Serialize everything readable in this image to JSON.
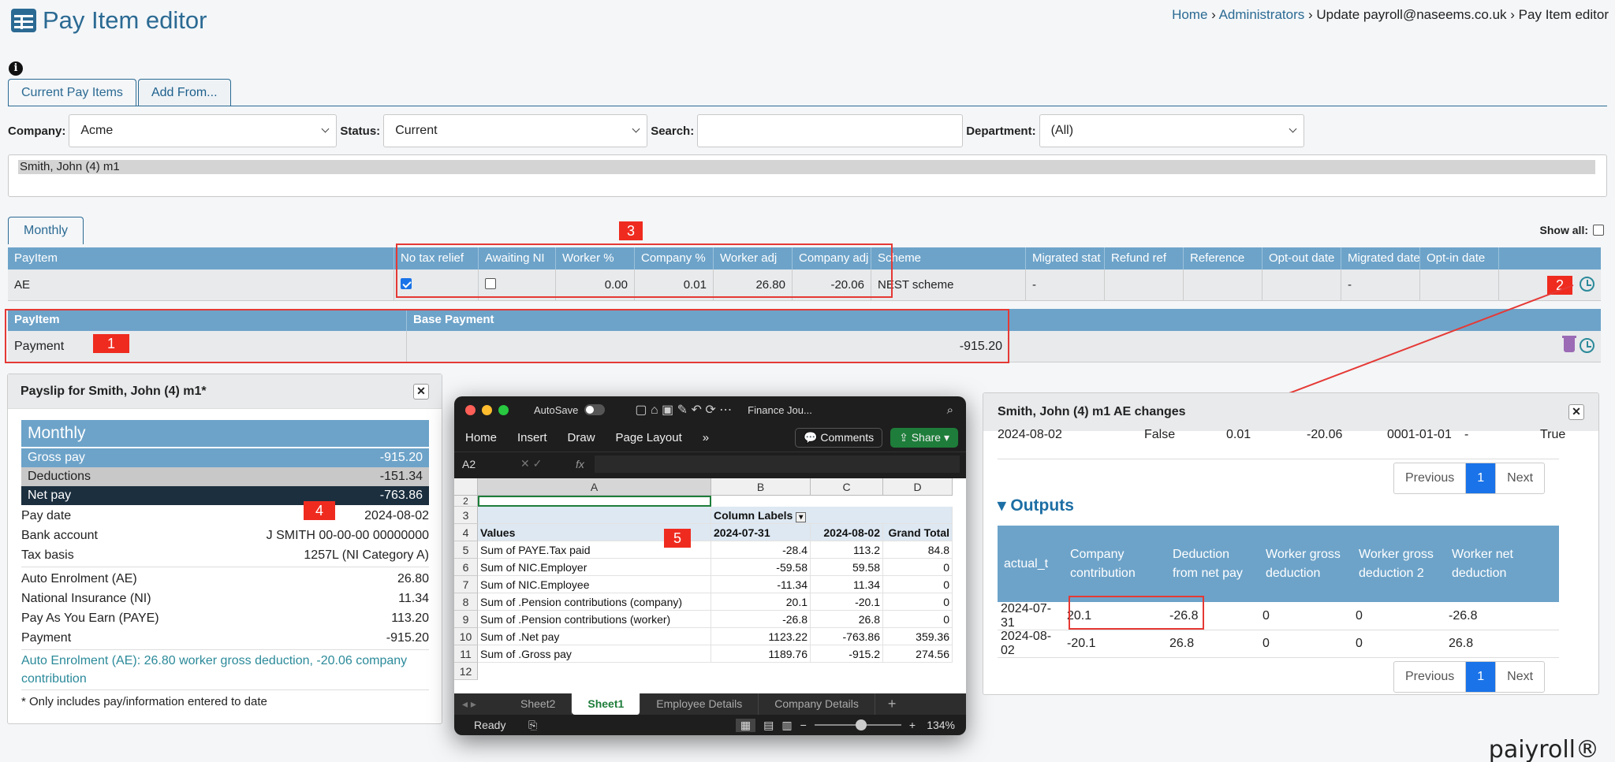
{
  "header": {
    "title": "Pay Item editor",
    "breadcrumb": {
      "home": "Home",
      "admins": "Administrators",
      "update": "Update payroll@naseems.co.uk",
      "current": "Pay Item editor"
    }
  },
  "tabs": [
    "Current Pay Items",
    "Add From..."
  ],
  "filters": {
    "company_label": "Company:",
    "company_value": "Acme",
    "status_label": "Status:",
    "status_value": "Current",
    "search_label": "Search:",
    "search_value": "",
    "dept_label": "Department:",
    "dept_value": "(All)"
  },
  "employee": "Smith, John (4) m1",
  "period_tab": "Monthly",
  "show_all": "Show all:",
  "ae_grid": {
    "headers": [
      "PayItem",
      "No tax relief",
      "Awaiting NI",
      "Worker %",
      "Company %",
      "Worker adj",
      "Company adj",
      "Scheme",
      "Migrated stat",
      "Refund ref",
      "Reference",
      "Opt-out date",
      "Migrated date",
      "Opt-in date"
    ],
    "row": {
      "payitem": "AE",
      "worker_pct": "0.00",
      "company_pct": "0.01",
      "worker_adj": "26.80",
      "company_adj": "-20.06",
      "scheme": "NEST scheme",
      "migrated": "-",
      "migrated_date": "-"
    }
  },
  "pay_grid": {
    "headers": [
      "PayItem",
      "Base Payment"
    ],
    "row": {
      "payitem": "Payment",
      "base": "-915.20"
    }
  },
  "tags": {
    "t1": "1",
    "t2": "2",
    "t3": "3",
    "t4": "4",
    "t5": "5"
  },
  "payslip": {
    "title": "Payslip for Smith, John (4) m1*",
    "period": "Monthly",
    "gross_label": "Gross pay",
    "gross": "-915.20",
    "ded_label": "Deductions",
    "ded": "-151.34",
    "net_label": "Net pay",
    "net": "-763.86",
    "paydate_label": "Pay date",
    "paydate": "2024-08-02",
    "bank_label": "Bank account",
    "bank": "J SMITH 00-00-00 00000000",
    "tax_label": "Tax basis",
    "tax": "1257L (NI Category A)",
    "items": [
      {
        "label": "Auto Enrolment (AE)",
        "value": "26.80"
      },
      {
        "label": "National Insurance (NI)",
        "value": "11.34"
      },
      {
        "label": "Pay As You Earn (PAYE)",
        "value": "113.20"
      },
      {
        "label": "Payment",
        "value": "-915.20"
      }
    ],
    "note": "Auto Enrolment (AE): 26.80 worker gross deduction, -20.06 company contribution",
    "footnote": "* Only includes pay/information entered to date"
  },
  "excel": {
    "autosave": "AutoSave",
    "file": "Finance Jou...",
    "menu": [
      "Home",
      "Insert",
      "Draw",
      "Page Layout"
    ],
    "comments": "Comments",
    "share": "Share",
    "cellref": "A2",
    "fx": "fx",
    "cols": [
      "A",
      "B",
      "C",
      "D"
    ],
    "col_labels": "Column Labels",
    "values_label": "Values",
    "d1": "2024-07-31",
    "d2": "2024-08-02",
    "grand": "Grand Total",
    "rows": [
      {
        "n": "5",
        "a": "Sum of PAYE.Tax paid",
        "b": "-28.4",
        "c": "113.2",
        "d": "84.8"
      },
      {
        "n": "6",
        "a": "Sum of NIC.Employer",
        "b": "-59.58",
        "c": "59.58",
        "d": "0"
      },
      {
        "n": "7",
        "a": "Sum of NIC.Employee",
        "b": "-11.34",
        "c": "11.34",
        "d": "0"
      },
      {
        "n": "8",
        "a": "Sum of .Pension contributions (company)",
        "b": "20.1",
        "c": "-20.1",
        "d": "0"
      },
      {
        "n": "9",
        "a": "Sum of .Pension contributions (worker)",
        "b": "-26.8",
        "c": "26.8",
        "d": "0"
      },
      {
        "n": "10",
        "a": "Sum of .Net pay",
        "b": "1123.22",
        "c": "-763.86",
        "d": "359.36"
      },
      {
        "n": "11",
        "a": "Sum of .Gross pay",
        "b": "1189.76",
        "c": "-915.2",
        "d": "274.56"
      }
    ],
    "sheets": [
      "Sheet2",
      "Sheet1",
      "Employee Details",
      "Company Details"
    ],
    "status": "Ready",
    "zoom": "134%"
  },
  "ae_changes": {
    "title": "Smith, John (4) m1 AE changes",
    "top_row": [
      "2024-08-02",
      "False",
      "0.01",
      "-20.06",
      "0001-01-01",
      "-",
      "True"
    ],
    "pager": [
      "Previous",
      "1",
      "Next"
    ],
    "outputs": "Outputs",
    "headers": [
      "actual_t",
      "Company contribution",
      "Deduction from net pay",
      "Worker gross deduction",
      "Worker gross deduction 2",
      "Worker net deduction"
    ],
    "rows": [
      [
        "2024-07-31",
        "20.1",
        "-26.8",
        "0",
        "0",
        "-26.8"
      ],
      [
        "2024-08-02",
        "-20.1",
        "26.8",
        "0",
        "0",
        "26.8"
      ]
    ]
  },
  "logo": "paiyroll®"
}
